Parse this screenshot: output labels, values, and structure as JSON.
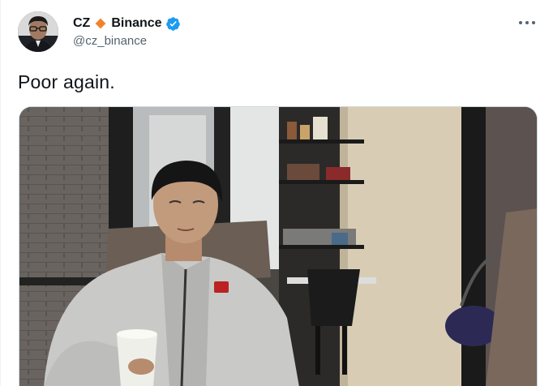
{
  "author": {
    "display_name": "CZ",
    "display_name_suffix": "Binance",
    "handle": "@cz_binance",
    "avatar_icon": "avatar-photo",
    "verified_icon": "verified-badge-icon",
    "diamond_icon": "binance-diamond-icon"
  },
  "tweet": {
    "text": "Poor again."
  },
  "actions": {
    "more_icon": "more-options-icon"
  },
  "media": {
    "type": "photo"
  },
  "colors": {
    "text_primary": "#0f1419",
    "text_secondary": "#536471",
    "verified_blue": "#1d9bf0",
    "binance_orange": "#f0832a",
    "border": "#cfd9de"
  }
}
